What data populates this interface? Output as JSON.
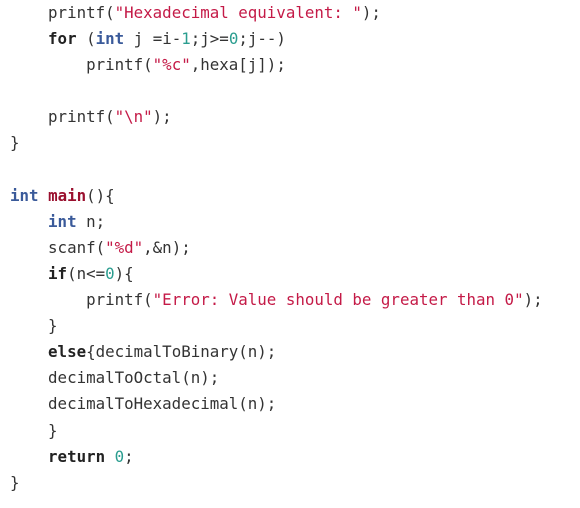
{
  "code": {
    "lines": [
      [
        {
          "t": "    printf(",
          "c": "pl"
        },
        {
          "t": "\"Hexadecimal equivalent: \"",
          "c": "st"
        },
        {
          "t": ");",
          "c": "pl"
        }
      ],
      [
        {
          "t": "    ",
          "c": "pl"
        },
        {
          "t": "for",
          "c": "kw"
        },
        {
          "t": " (",
          "c": "pl"
        },
        {
          "t": "int",
          "c": "ty"
        },
        {
          "t": " j =i-",
          "c": "pl"
        },
        {
          "t": "1",
          "c": "nu"
        },
        {
          "t": ";j>=",
          "c": "pl"
        },
        {
          "t": "0",
          "c": "nu"
        },
        {
          "t": ";j--)",
          "c": "pl"
        }
      ],
      [
        {
          "t": "        printf(",
          "c": "pl"
        },
        {
          "t": "\"%c\"",
          "c": "st"
        },
        {
          "t": ",hexa[j]);",
          "c": "pl"
        }
      ],
      [
        {
          "t": "",
          "c": "pl"
        }
      ],
      [
        {
          "t": "    printf(",
          "c": "pl"
        },
        {
          "t": "\"\\n\"",
          "c": "st"
        },
        {
          "t": ");",
          "c": "pl"
        }
      ],
      [
        {
          "t": "}",
          "c": "pl"
        }
      ],
      [
        {
          "t": "",
          "c": "pl"
        }
      ],
      [
        {
          "t": "int",
          "c": "ty"
        },
        {
          "t": " ",
          "c": "pl"
        },
        {
          "t": "main",
          "c": "fn"
        },
        {
          "t": "(){",
          "c": "pl"
        }
      ],
      [
        {
          "t": "    ",
          "c": "pl"
        },
        {
          "t": "int",
          "c": "ty"
        },
        {
          "t": " n;",
          "c": "pl"
        }
      ],
      [
        {
          "t": "    scanf(",
          "c": "pl"
        },
        {
          "t": "\"%d\"",
          "c": "st"
        },
        {
          "t": ",&n);",
          "c": "pl"
        }
      ],
      [
        {
          "t": "    ",
          "c": "pl"
        },
        {
          "t": "if",
          "c": "kw"
        },
        {
          "t": "(n<=",
          "c": "pl"
        },
        {
          "t": "0",
          "c": "nu"
        },
        {
          "t": "){",
          "c": "pl"
        }
      ],
      [
        {
          "t": "        printf(",
          "c": "pl"
        },
        {
          "t": "\"Error: Value should be greater than 0\"",
          "c": "st"
        },
        {
          "t": ");",
          "c": "pl"
        }
      ],
      [
        {
          "t": "    }",
          "c": "pl"
        }
      ],
      [
        {
          "t": "    ",
          "c": "pl"
        },
        {
          "t": "else",
          "c": "kw"
        },
        {
          "t": "{decimalToBinary(n);",
          "c": "pl"
        }
      ],
      [
        {
          "t": "    decimalToOctal(n);",
          "c": "pl"
        }
      ],
      [
        {
          "t": "    decimalToHexadecimal(n);",
          "c": "pl"
        }
      ],
      [
        {
          "t": "    }",
          "c": "pl"
        }
      ],
      [
        {
          "t": "    ",
          "c": "pl"
        },
        {
          "t": "return",
          "c": "kw"
        },
        {
          "t": " ",
          "c": "pl"
        },
        {
          "t": "0",
          "c": "nu"
        },
        {
          "t": ";",
          "c": "pl"
        }
      ],
      [
        {
          "t": "}",
          "c": "pl"
        }
      ]
    ]
  },
  "colors": {
    "background": "#ffffff",
    "keyword": "#222222",
    "type": "#3a5a9a",
    "function": "#9a0f2e",
    "string": "#c41a47",
    "number": "#2a9d8f",
    "plain": "#333333"
  }
}
